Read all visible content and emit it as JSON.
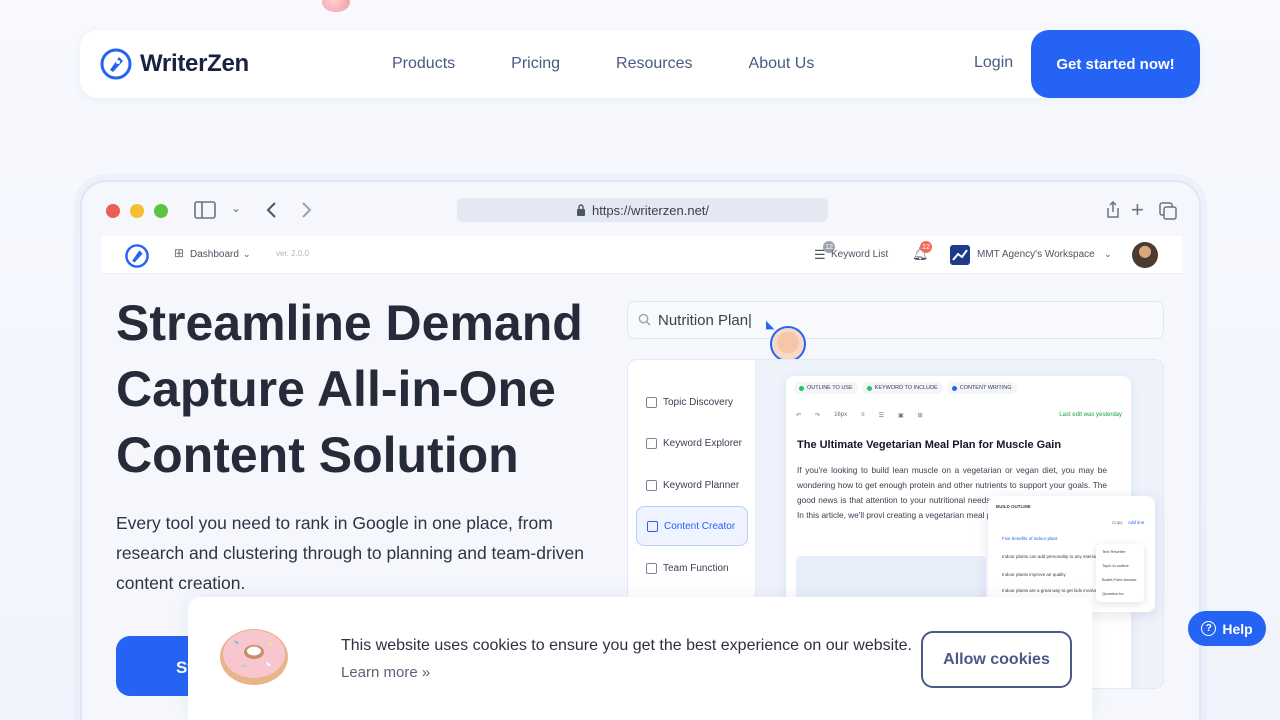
{
  "brand": {
    "name": "WriterZen",
    "accent": "#2563f5"
  },
  "nav": {
    "links": [
      "Products",
      "Pricing",
      "Resources",
      "About Us"
    ],
    "login": "Login",
    "cta": "Get started now!"
  },
  "browser": {
    "url": "https://writerzen.net/",
    "icons": [
      "sidebar-icon",
      "chevron-down-icon",
      "back-icon",
      "forward-icon",
      "lock-icon",
      "share-icon",
      "plus-icon",
      "tabs-icon"
    ]
  },
  "app": {
    "dashboard": "Dashboard",
    "version": "ver. 2.0.0",
    "keyword_list": "Keyword List",
    "keyword_badge": "12",
    "notif_badge": "12",
    "workspace": "MMT Agency's Workspace"
  },
  "hero": {
    "title": "Streamline Demand Capture All-in-One Content Solution",
    "subtitle": "Every tool you need to rank in Google in one place, from research and clustering through to planning and team-driven content creation.",
    "button_partial": "St"
  },
  "search": {
    "value": "Nutrition Plan|"
  },
  "sidebar": {
    "items": [
      {
        "label": "Topic Discovery",
        "active": false
      },
      {
        "label": "Keyword Explorer",
        "active": false
      },
      {
        "label": "Keyword Planner",
        "active": false
      },
      {
        "label": "Content Creator",
        "active": true
      },
      {
        "label": "Team Function",
        "active": false
      }
    ]
  },
  "editor": {
    "chips": [
      "OUTLINE TO USE",
      "KEYWORD TO INCLUDE",
      "CONTENT WRITING"
    ],
    "font_size": "16px",
    "last_edit": "Last edit was yesterday",
    "title": "The Ultimate Vegetarian Meal Plan for Muscle Gain",
    "body": "If you're looking to build lean muscle on a vegetarian or vegan diet, you may be wondering how to get enough protein and other nutrients to support your goals. The good news is that attention to your nutritional needs, it's entirely a plant-based diet. In this article, we'll provi creating a vegetarian meal plan for muscle gain"
  },
  "outline": {
    "title": "BUILD OUTLINE",
    "actions": [
      "Copy",
      "Add line"
    ],
    "rows": [
      "Five benefits of indoor plant",
      "Indoor plants can add personality to any interior",
      "Indoor plants improve air quality",
      "Indoor plants are a great way to get kids involved"
    ],
    "menu": [
      "Text Rewriter",
      "Topic to outline",
      "Bullet-Point Answer",
      "Question for"
    ]
  },
  "cookie": {
    "text": "This website uses cookies to ensure you get the best experience on our website.",
    "link": "Learn more »",
    "button": "Allow cookies"
  },
  "help": {
    "label": "Help"
  }
}
